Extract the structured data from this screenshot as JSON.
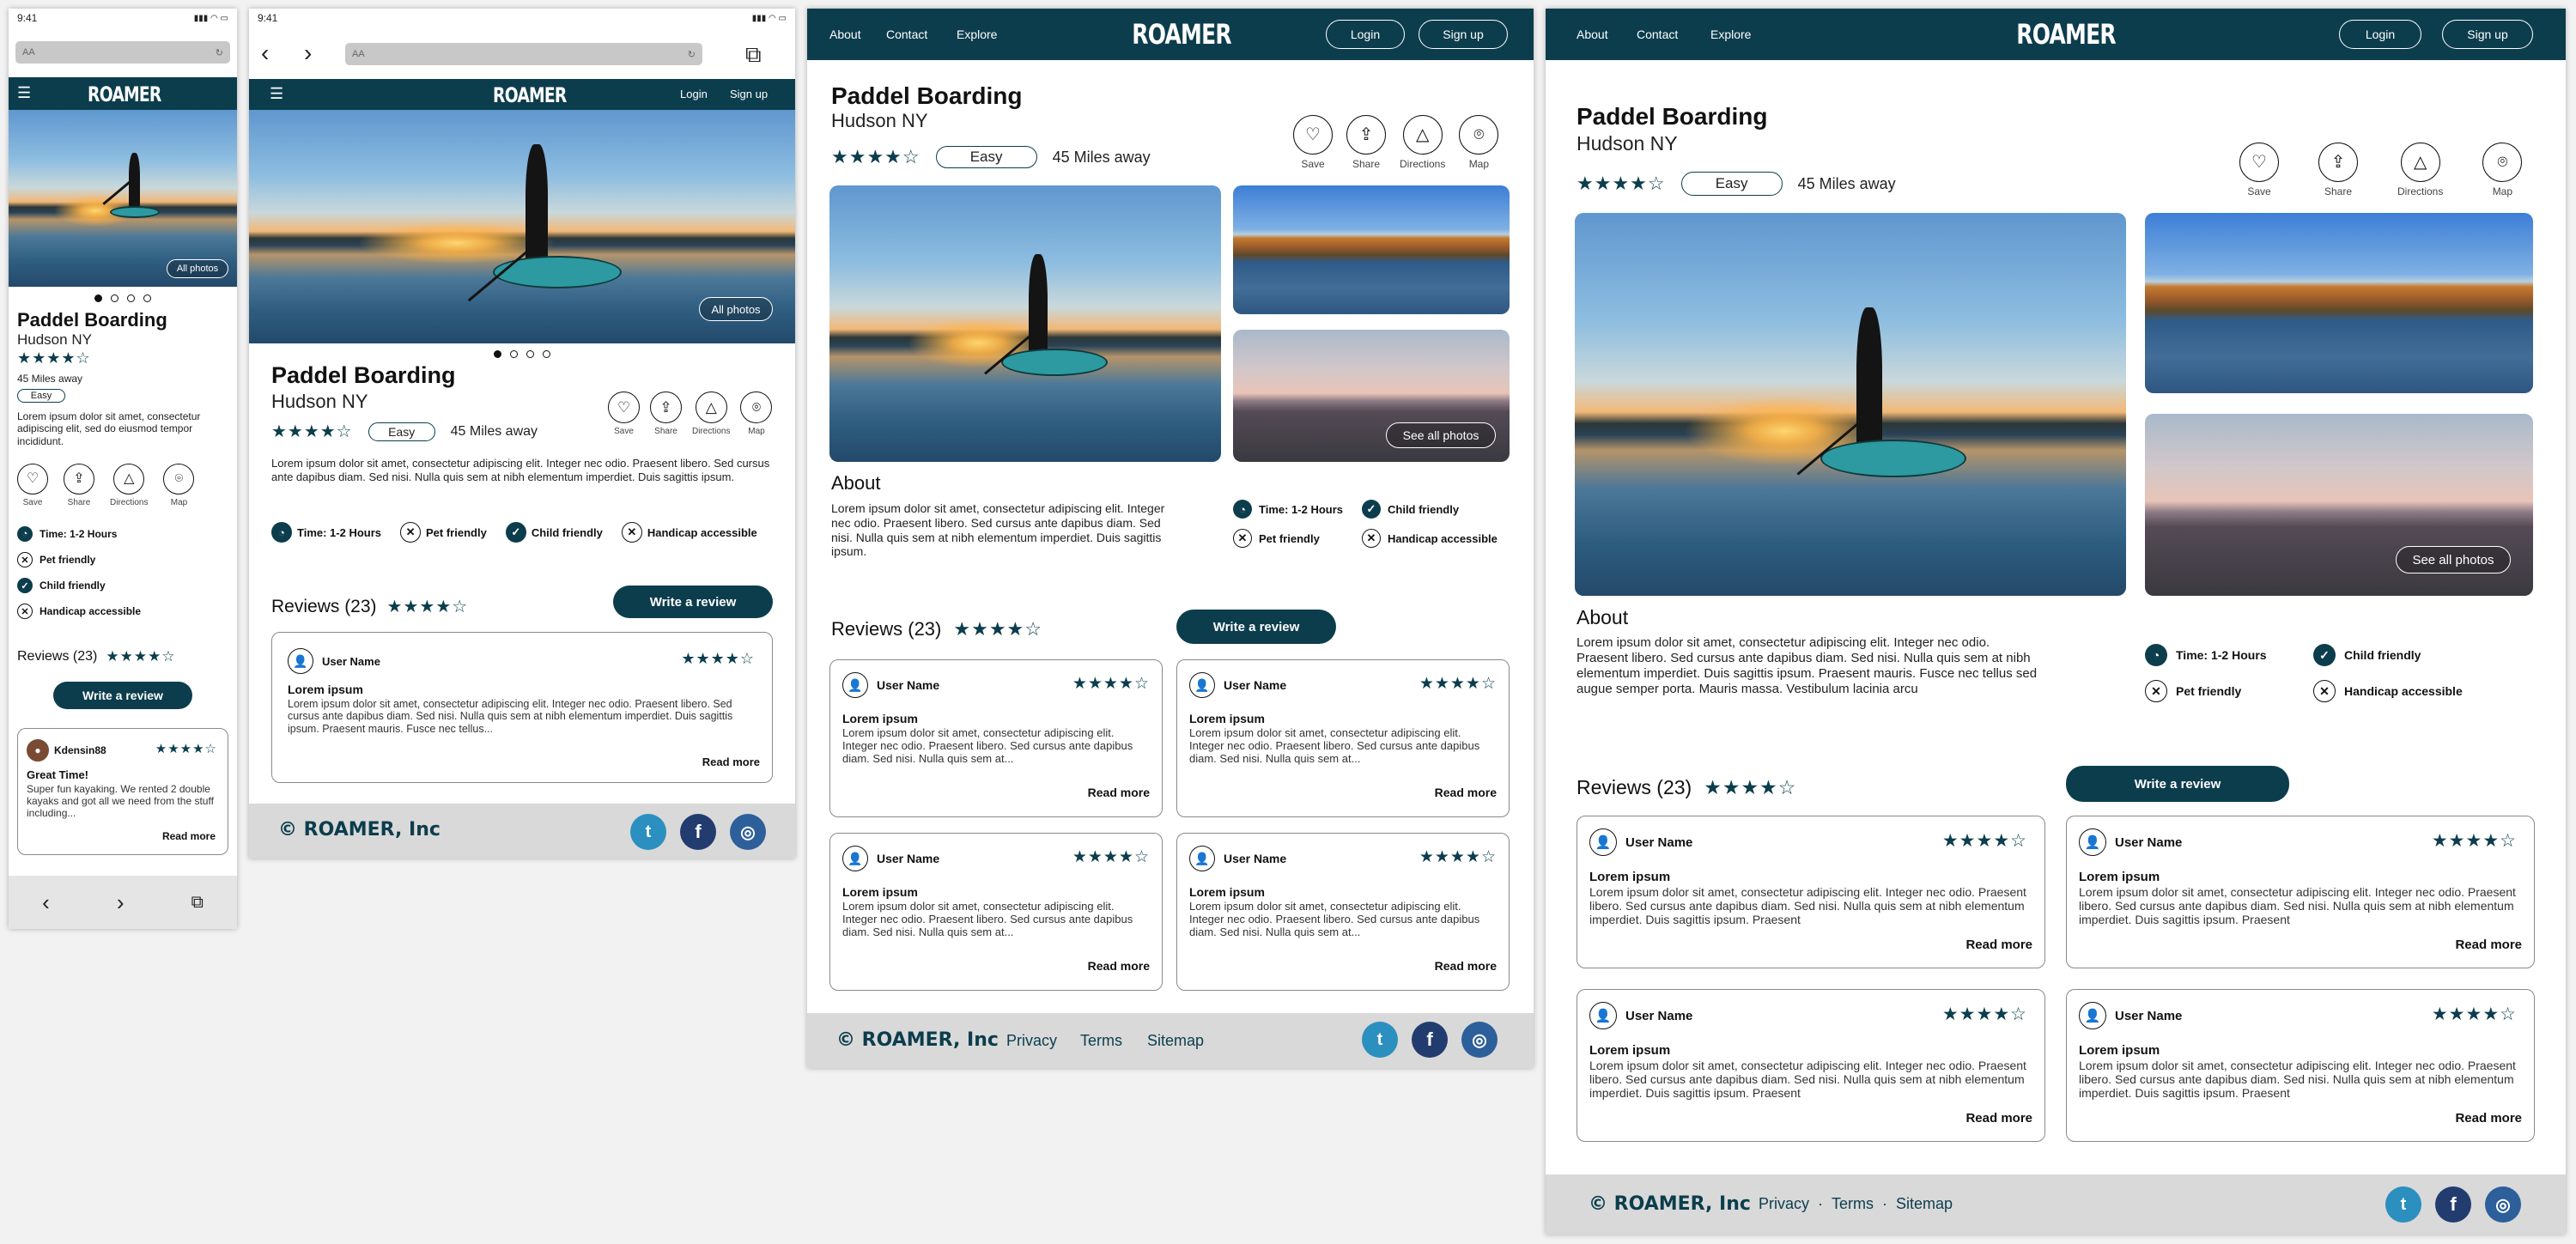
{
  "brand": "ROAMER",
  "status_time": "9:41",
  "url_text": "AA",
  "nav": {
    "about": "About",
    "contact": "Contact",
    "explore": "Explore",
    "login": "Login",
    "signup": "Sign up"
  },
  "activity": {
    "title": "Paddel Boarding",
    "location": "Hudson NY",
    "rating_stars": "★★★★☆",
    "difficulty": "Easy",
    "distance": "45 Miles away",
    "short_desc": "Lorem ipsum dolor sit amet, consectetur adipiscing elit, sed do eiusmod tempor incididunt.",
    "desc_tablet": "Lorem ipsum dolor sit amet, consectetur adipiscing elit. Integer nec odio. Praesent libero. Sed cursus ante dapibus diam. Sed nisi. Nulla quis sem at nibh elementum imperdiet. Duis sagittis ipsum.",
    "desc_desktop": "Lorem ipsum dolor sit amet, consectetur adipiscing elit. Integer nec odio. Praesent libero. Sed cursus ante dapibus diam. Sed nisi. Nulla quis sem at nibh elementum imperdiet. Duis sagittis ipsum.",
    "desc_wide": "Lorem ipsum dolor sit amet, consectetur adipiscing elit. Integer nec odio. Praesent libero. Sed cursus ante dapibus diam. Sed nisi. Nulla quis sem at nibh elementum imperdiet. Duis sagittis ipsum. Praesent mauris. Fusce nec tellus sed augue semper porta. Mauris massa. Vestibulum lacinia arcu"
  },
  "photos": {
    "all": "All photos",
    "see_all": "See all photos"
  },
  "actions": {
    "save": "Save",
    "share": "Share",
    "directions": "Directions",
    "map": "Map"
  },
  "features": {
    "time": "Time: 1-2 Hours",
    "pet": "Pet friendly",
    "child": "Child friendly",
    "handicap": "Handicap accessible"
  },
  "about_heading": "About",
  "reviews": {
    "heading": "Reviews (23)",
    "stars": "★★★★☆",
    "write": "Write a review",
    "read_more": "Read more",
    "mobile_user": "Kdensin88",
    "mobile_title": "Great Time!",
    "mobile_body": "Super fun kayaking. We rented 2 double kayaks and got all we need from the stuff including...",
    "user": "User Name",
    "title": "Lorem ipsum",
    "body_tablet": "Lorem ipsum dolor sit amet, consectetur adipiscing elit. Integer nec odio. Praesent libero. Sed cursus ante dapibus diam. Sed nisi. Nulla quis sem at nibh elementum imperdiet. Duis sagittis ipsum. Praesent mauris. Fusce nec tellus...",
    "body_card": "Lorem ipsum dolor sit amet, consectetur adipiscing elit. Integer nec odio. Praesent libero. Sed cursus ante dapibus diam. Sed nisi. Nulla quis sem at...",
    "body_wide": "Lorem ipsum dolor sit amet, consectetur adipiscing elit. Integer nec odio. Praesent libero. Sed cursus ante dapibus diam. Sed nisi. Nulla quis sem at nibh elementum imperdiet. Duis sagittis ipsum. Praesent"
  },
  "footer": {
    "copyright": "© ROAMER, Inc",
    "privacy": "Privacy",
    "terms": "Terms",
    "sitemap": "Sitemap",
    "sep": "·"
  },
  "social": {
    "twitter": "t",
    "facebook": "f",
    "instagram": "◎"
  },
  "colors": {
    "brand": "#0c3d4d",
    "twitter": "#2b8fbf",
    "facebook": "#233c70",
    "instagram": "#2d5f9a"
  }
}
